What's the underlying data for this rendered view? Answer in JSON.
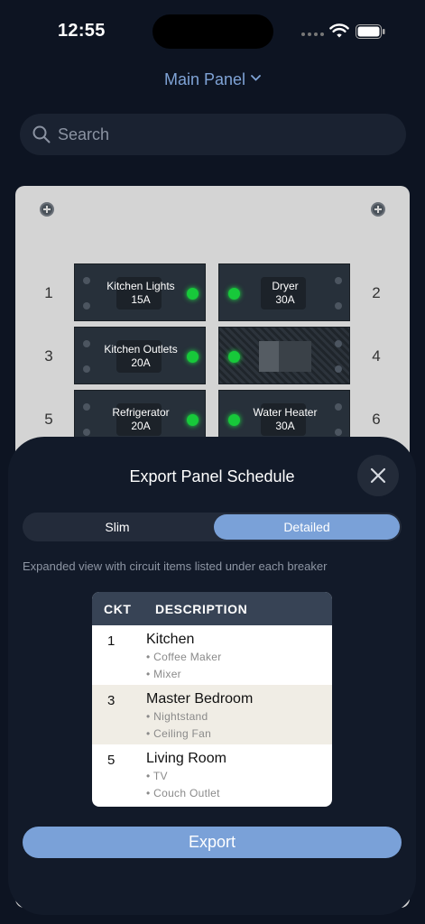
{
  "status": {
    "time": "12:55"
  },
  "header": {
    "panel_name": "Main Panel"
  },
  "search": {
    "placeholder": "Search"
  },
  "panel": {
    "rows": [
      {
        "left_num": "1",
        "right_num": "2",
        "left": {
          "name": "Kitchen Lights",
          "amps": "15A"
        },
        "right": {
          "name": "Dryer",
          "amps": "30A"
        }
      },
      {
        "left_num": "3",
        "right_num": "4",
        "left": {
          "name": "Kitchen Outlets",
          "amps": "20A"
        },
        "right": {
          "name": "",
          "amps": ""
        }
      },
      {
        "left_num": "5",
        "right_num": "6",
        "left": {
          "name": "Refrigerator",
          "amps": "20A"
        },
        "right": {
          "name": "Water Heater",
          "amps": "30A"
        }
      }
    ]
  },
  "sheet": {
    "title": "Export Panel Schedule",
    "options": [
      "Slim",
      "Detailed"
    ],
    "selected": "Detailed",
    "description": "Expanded view with circuit items listed under each breaker",
    "table": {
      "headers": [
        "CKT",
        "DESCRIPTION"
      ],
      "rows": [
        {
          "ckt": "1",
          "name": "Kitchen",
          "items": [
            "• Coffee Maker",
            "• Mixer"
          ]
        },
        {
          "ckt": "3",
          "name": "Master Bedroom",
          "items": [
            "• Nightstand",
            "• Ceiling Fan"
          ]
        },
        {
          "ckt": "5",
          "name": "Living Room",
          "items": [
            "• TV",
            "• Couch Outlet"
          ]
        }
      ]
    },
    "export_label": "Export"
  },
  "colors": {
    "accent": "#7aa1d8",
    "background": "#0d1422",
    "led_on": "#17c93a"
  }
}
